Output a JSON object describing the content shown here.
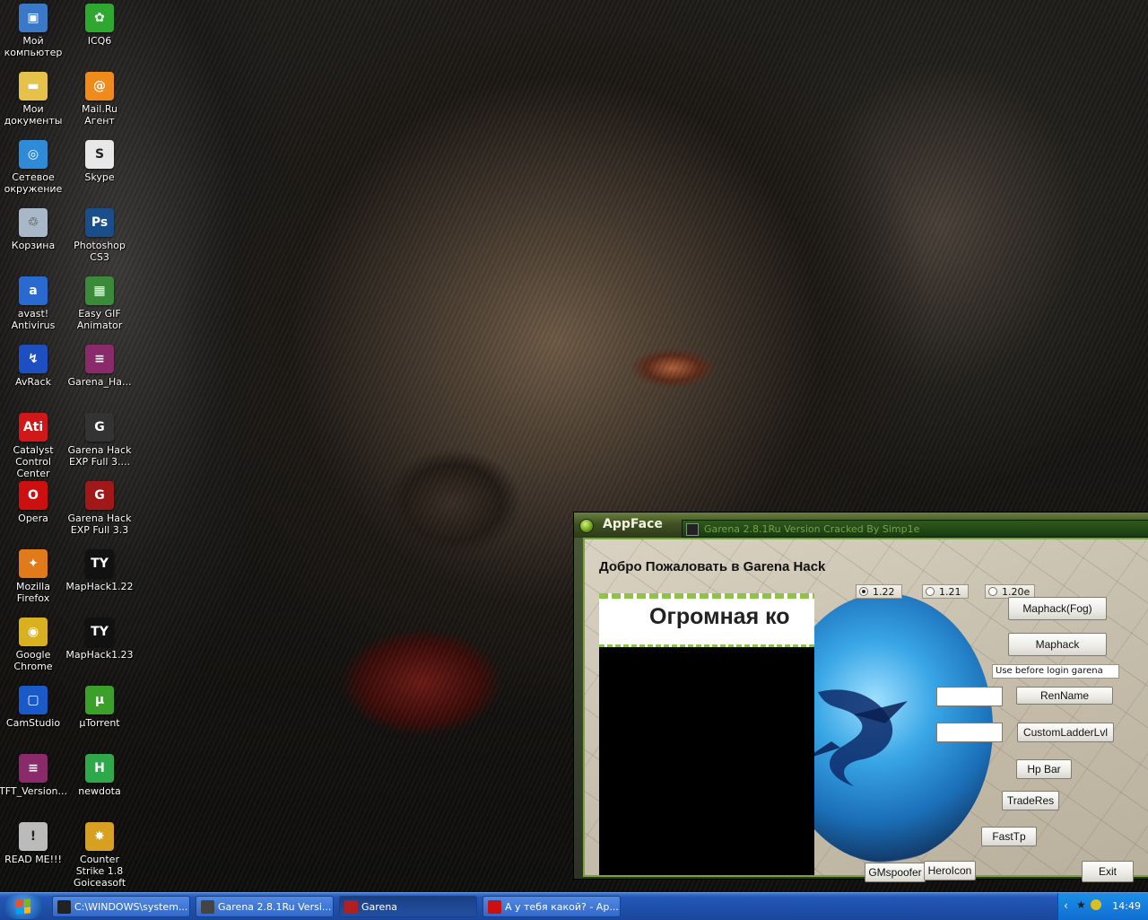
{
  "desktop": {
    "icons": [
      {
        "label": "Мой компьютер",
        "icon": "computer-icon",
        "color": "#3b78c8"
      },
      {
        "label": "ICQ6",
        "icon": "icq-icon",
        "color": "#2ea82e"
      },
      {
        "label": "Мои документы",
        "icon": "folder-icon",
        "color": "#e6c24a"
      },
      {
        "label": "Mail.Ru Агент",
        "icon": "mailru-agent-icon",
        "color": "#f08a1a"
      },
      {
        "label": "Сетевое окружение",
        "icon": "network-icon",
        "color": "#2f8ad8"
      },
      {
        "label": "Skype",
        "icon": "skype-icon",
        "color": "#e8e8e8"
      },
      {
        "label": "Корзина",
        "icon": "recycle-bin-icon",
        "color": "#a8b8c8"
      },
      {
        "label": "Photoshop CS3",
        "icon": "photoshop-icon",
        "color": "#1a4e8a"
      },
      {
        "label": "avast! Antivirus",
        "icon": "avast-icon",
        "color": "#2a6ad0"
      },
      {
        "label": "Easy GIF Animator",
        "icon": "gif-animator-icon",
        "color": "#3a8a3a"
      },
      {
        "label": "AvRack",
        "icon": "avrack-icon",
        "color": "#1d4fc0"
      },
      {
        "label": "Garena_Ha...",
        "icon": "winrar-icon",
        "color": "#8a2a6a"
      },
      {
        "label": "Catalyst Control Center",
        "icon": "ati-icon",
        "color": "#d01818"
      },
      {
        "label": "Garena Hack EXP Full 3....",
        "icon": "garena-icon",
        "color": "#333333"
      },
      {
        "label": "Opera",
        "icon": "opera-icon",
        "color": "#cc1010"
      },
      {
        "label": "Garena Hack EXP Full 3.3",
        "icon": "garena-shortcut-icon",
        "color": "#a01818"
      },
      {
        "label": "Mozilla Firefox",
        "icon": "firefox-icon",
        "color": "#e07a1a"
      },
      {
        "label": "MapHack1.22",
        "icon": "maphack-icon",
        "color": "#111111"
      },
      {
        "label": "Google Chrome",
        "icon": "chrome-icon",
        "color": "#d8b020"
      },
      {
        "label": "MapHack1.23",
        "icon": "maphack-icon",
        "color": "#111111"
      },
      {
        "label": "CamStudio",
        "icon": "camstudio-icon",
        "color": "#1a5ac8"
      },
      {
        "label": "µTorrent",
        "icon": "utorrent-icon",
        "color": "#3aa02a"
      },
      {
        "label": "TFT_Version...",
        "icon": "winrar-icon",
        "color": "#8a2a6a"
      },
      {
        "label": "newdota",
        "icon": "newdota-icon",
        "color": "#2ea84a"
      },
      {
        "label": "READ ME!!!",
        "icon": "readme-icon",
        "color": "#bbbbbb"
      },
      {
        "label": "Counter Strike 1.8 Goiceasoft",
        "icon": "counter-strike-icon",
        "color": "#d8a020"
      }
    ]
  },
  "app": {
    "title": "AppFace",
    "inner_title": "Garena 2.8.1Ru Version Cracked By Simp1e",
    "welcome": "Добро Пожаловать в Garena Hack",
    "banner_text": "Огромная ко",
    "versions": [
      {
        "label": "1.22",
        "selected": true
      },
      {
        "label": "1.21",
        "selected": false
      },
      {
        "label": "1.20e",
        "selected": false
      }
    ],
    "buttons": {
      "maphack_fog": "Maphack(Fog)",
      "maphack": "Maphack",
      "renname": "RenName",
      "customladder": "CustomLadderLvl",
      "hpbar": "Hp Bar",
      "traderes": "TradeRes",
      "fasttp": "FastTp",
      "gmspoofer": "GMspoofer",
      "heroicon": "HeroIcon",
      "exit": "Exit"
    },
    "note": "Use before login garena",
    "name_field_value": "",
    "ladder_field_value": ""
  },
  "taskbar": {
    "items": [
      {
        "label": "C:\\WINDOWS\\system...",
        "active": false,
        "icon": "cmd-icon"
      },
      {
        "label": "Garena 2.8.1Ru Versi...",
        "active": false,
        "icon": "garena-icon"
      },
      {
        "label": "Garena",
        "active": true,
        "icon": "garena-red-icon"
      },
      {
        "label": "А у тебя какой? - Ар...",
        "active": false,
        "icon": "opera-icon"
      }
    ],
    "clock": "14:49"
  }
}
